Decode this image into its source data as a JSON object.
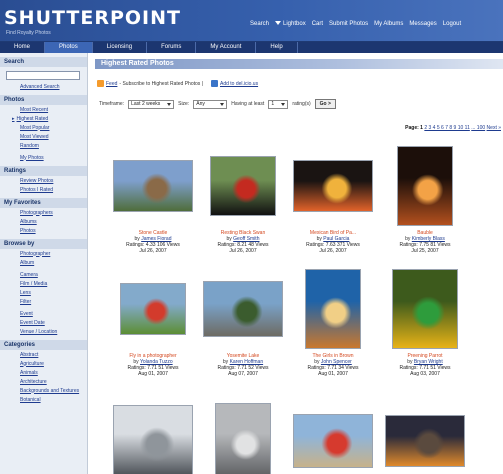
{
  "header": {
    "logo": "SHUTTERPOINT",
    "tagline": "Find Royalty Photos",
    "nav": [
      "Search",
      "Lightbox",
      "Cart",
      "Submit Photos",
      "My Albums",
      "Messages",
      "Logout"
    ]
  },
  "tabs": [
    {
      "label": "Home"
    },
    {
      "label": "Photos"
    },
    {
      "label": "Licensing"
    },
    {
      "label": "Forums"
    },
    {
      "label": "My Account"
    },
    {
      "label": "Help"
    }
  ],
  "sidebar": {
    "search_head": "Search",
    "advanced_search": "Advanced Search",
    "photos_head": "Photos",
    "photos_links": [
      "Most Recent",
      "Highest Rated",
      "Most Popular",
      "Most Viewed",
      "Random"
    ],
    "my_photos": "My Photos",
    "ratings_head": "Ratings",
    "ratings_links": [
      "Review Photos",
      "Photos I Rated"
    ],
    "favorites_head": "My Favorites",
    "favorites_links": [
      "Photographers",
      "Albums",
      "Photos"
    ],
    "browse_head": "Browse by",
    "browse_links_a": [
      "Photographer",
      "Album"
    ],
    "browse_links_b": [
      "Camera",
      "Film / Media",
      "Lens",
      "Filter"
    ],
    "browse_links_c": [
      "Event",
      "Event Date",
      "Venue / Location"
    ],
    "categories_head": "Categories",
    "categories_links": [
      "Abstract",
      "Agriculture",
      "Animals",
      "Architecture",
      "Backgrounds and Textures",
      "Botanical"
    ]
  },
  "main": {
    "title": "Highest Rated Photos",
    "feed_label": "Feed",
    "feed_text": "- Subscribe to Highest Rated Photos |",
    "add_label": "Add to del.icio.us",
    "filters": {
      "timeframe_label": "Timeframe:",
      "timeframe_value": "Last 2 weeks",
      "sort_label": "Size:",
      "sort_value": "Any",
      "having_label": "Having at least",
      "having_value": "1",
      "rating_label": "rating(s)",
      "go_label": "Go >"
    },
    "pager": {
      "label": "Page:",
      "current": "1",
      "pages": "2 3 4 5 6 7 8 9 10 11",
      "of": "... 100",
      "next": "Next »"
    }
  },
  "photos": [
    {
      "title": "Stone Castle",
      "by": "James Fiorad",
      "rating": "Ratings: 4.33",
      "views": "106 Views",
      "date": "Jul 26, 2007",
      "colors": [
        "#7e9fcc",
        "#4f6d3b",
        "#8a6a48"
      ]
    },
    {
      "title": "Resting Black Swan",
      "by": "Geoff Smith",
      "rating": "Ratings: 8.21",
      "views": "48 Views",
      "date": "Jul 26, 2007",
      "colors": [
        "#6e8e52",
        "#111111",
        "#c42a20"
      ]
    },
    {
      "title": "Mexican Bird of Pa...",
      "by": "Paul Garcia",
      "rating": "Ratings: 7.63",
      "views": "371 Views",
      "date": "Jul 26, 2007",
      "colors": [
        "#1a1412",
        "#e2632a",
        "#f0b23c"
      ]
    },
    {
      "title": "Bauble",
      "by": "Kimberly Blass",
      "rating": "Ratings: 7.75",
      "views": "81 Views",
      "date": "Jul 25, 2007",
      "colors": [
        "#1c0f0a",
        "#b3501e",
        "#f3a246"
      ]
    },
    {
      "title": "Fly in a photographer",
      "by": "Yolanda Tuzzo",
      "rating": "Ratings: 7.71",
      "views": "51 Views",
      "date": "Aug 01, 2007",
      "colors": [
        "#83aacb",
        "#5c8e34",
        "#d33b2c"
      ]
    },
    {
      "title": "Yosemite Lake",
      "by": "Karen Hoffman",
      "rating": "Ratings: 7.71",
      "views": "52 Views",
      "date": "Aug 07, 2007",
      "colors": [
        "#7aa2c8",
        "#6d6b63",
        "#3b5c2e"
      ]
    },
    {
      "title": "The Girls in Brown",
      "by": "John Spencer",
      "rating": "Ratings: 7.71",
      "views": "34 Views",
      "date": "Aug 01, 2007",
      "colors": [
        "#1f63a8",
        "#c9782e",
        "#f1cf86"
      ]
    },
    {
      "title": "Preening Parrot",
      "by": "Bryan Wright",
      "rating": "Ratings: 7.71",
      "views": "51 Views",
      "date": "Aug 03, 2007",
      "colors": [
        "#3d5a1c",
        "#e8b317",
        "#2e9c3c"
      ]
    },
    {
      "title": "",
      "by": "",
      "rating": "",
      "views": "",
      "date": "",
      "colors": [
        "#d9dde2",
        "#4a4f55",
        "#8f959b"
      ]
    },
    {
      "title": "",
      "by": "",
      "rating": "",
      "views": "",
      "date": "",
      "colors": [
        "#b6b8bb",
        "#5a5c5f",
        "#e1e2e3"
      ]
    },
    {
      "title": "",
      "by": "",
      "rating": "",
      "views": "",
      "date": "",
      "colors": [
        "#8fb4d9",
        "#c7b28a",
        "#d63a2e"
      ]
    },
    {
      "title": "",
      "by": "",
      "rating": "",
      "views": "",
      "date": "",
      "colors": [
        "#2a2a3a",
        "#e08a2c",
        "#5a4a3e"
      ]
    }
  ]
}
